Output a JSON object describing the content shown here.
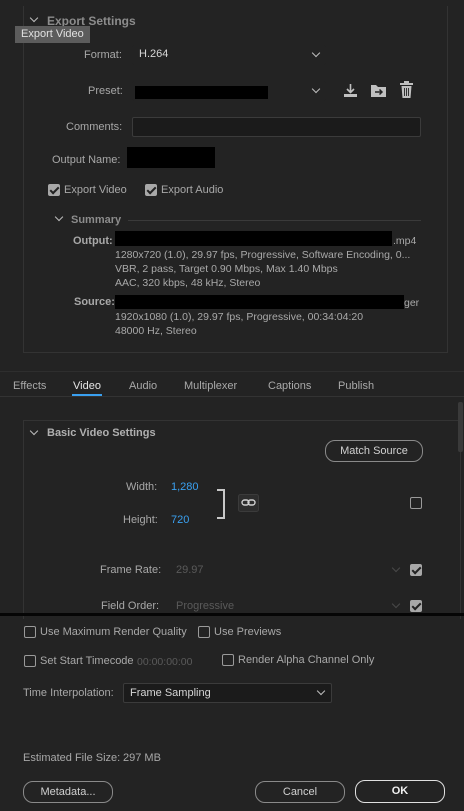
{
  "export_settings": {
    "heading": "Export Settings",
    "tooltip": "Export Video",
    "format_label": "Format:",
    "format_value": "H.264",
    "preset_label": "Preset:",
    "comments_label": "Comments:",
    "output_name_label": "Output Name:",
    "export_video_label": "Export Video",
    "export_video_checked": true,
    "export_audio_label": "Export Audio",
    "export_audio_checked": true
  },
  "summary": {
    "heading": "Summary",
    "output_label": "Output:",
    "output_suffix": ".mp4",
    "output_lines": [
      "1280x720 (1.0), 29.97 fps, Progressive, Software Encoding, 0...",
      "VBR, 2 pass, Target 0.90 Mbps, Max 1.40 Mbps",
      "AAC, 320 kbps, 48 kHz, Stereo"
    ],
    "source_label": "Source:",
    "source_suffix": "ger",
    "source_lines": [
      "1920x1080 (1.0), 29.97 fps, Progressive, 00:34:04:20",
      "48000 Hz, Stereo"
    ]
  },
  "tabs": [
    "Effects",
    "Video",
    "Audio",
    "Multiplexer",
    "Captions",
    "Publish"
  ],
  "active_tab": "Video",
  "video": {
    "section_title": "Basic Video Settings",
    "match_source_label": "Match Source",
    "width_label": "Width:",
    "width_value": "1,280",
    "height_label": "Height:",
    "height_value": "720",
    "frame_rate_label": "Frame Rate:",
    "frame_rate_value": "29.97",
    "field_order_label": "Field Order:",
    "field_order_value": "Progressive"
  },
  "bottom": {
    "max_render_label": "Use Maximum Render Quality",
    "use_previews_label": "Use Previews",
    "start_timecode_label": "Set Start Timecode",
    "start_timecode_value": "00:00:00:00",
    "render_alpha_label": "Render Alpha Channel Only",
    "time_interp_label": "Time Interpolation:",
    "time_interp_value": "Frame Sampling",
    "file_size_label": "Estimated File Size:",
    "file_size_value": "297 MB",
    "metadata_label": "Metadata...",
    "cancel_label": "Cancel",
    "ok_label": "OK"
  },
  "colors": {
    "accent_blue": "#3aa0f0",
    "background": "#232323",
    "field": "#1b1b1b"
  }
}
